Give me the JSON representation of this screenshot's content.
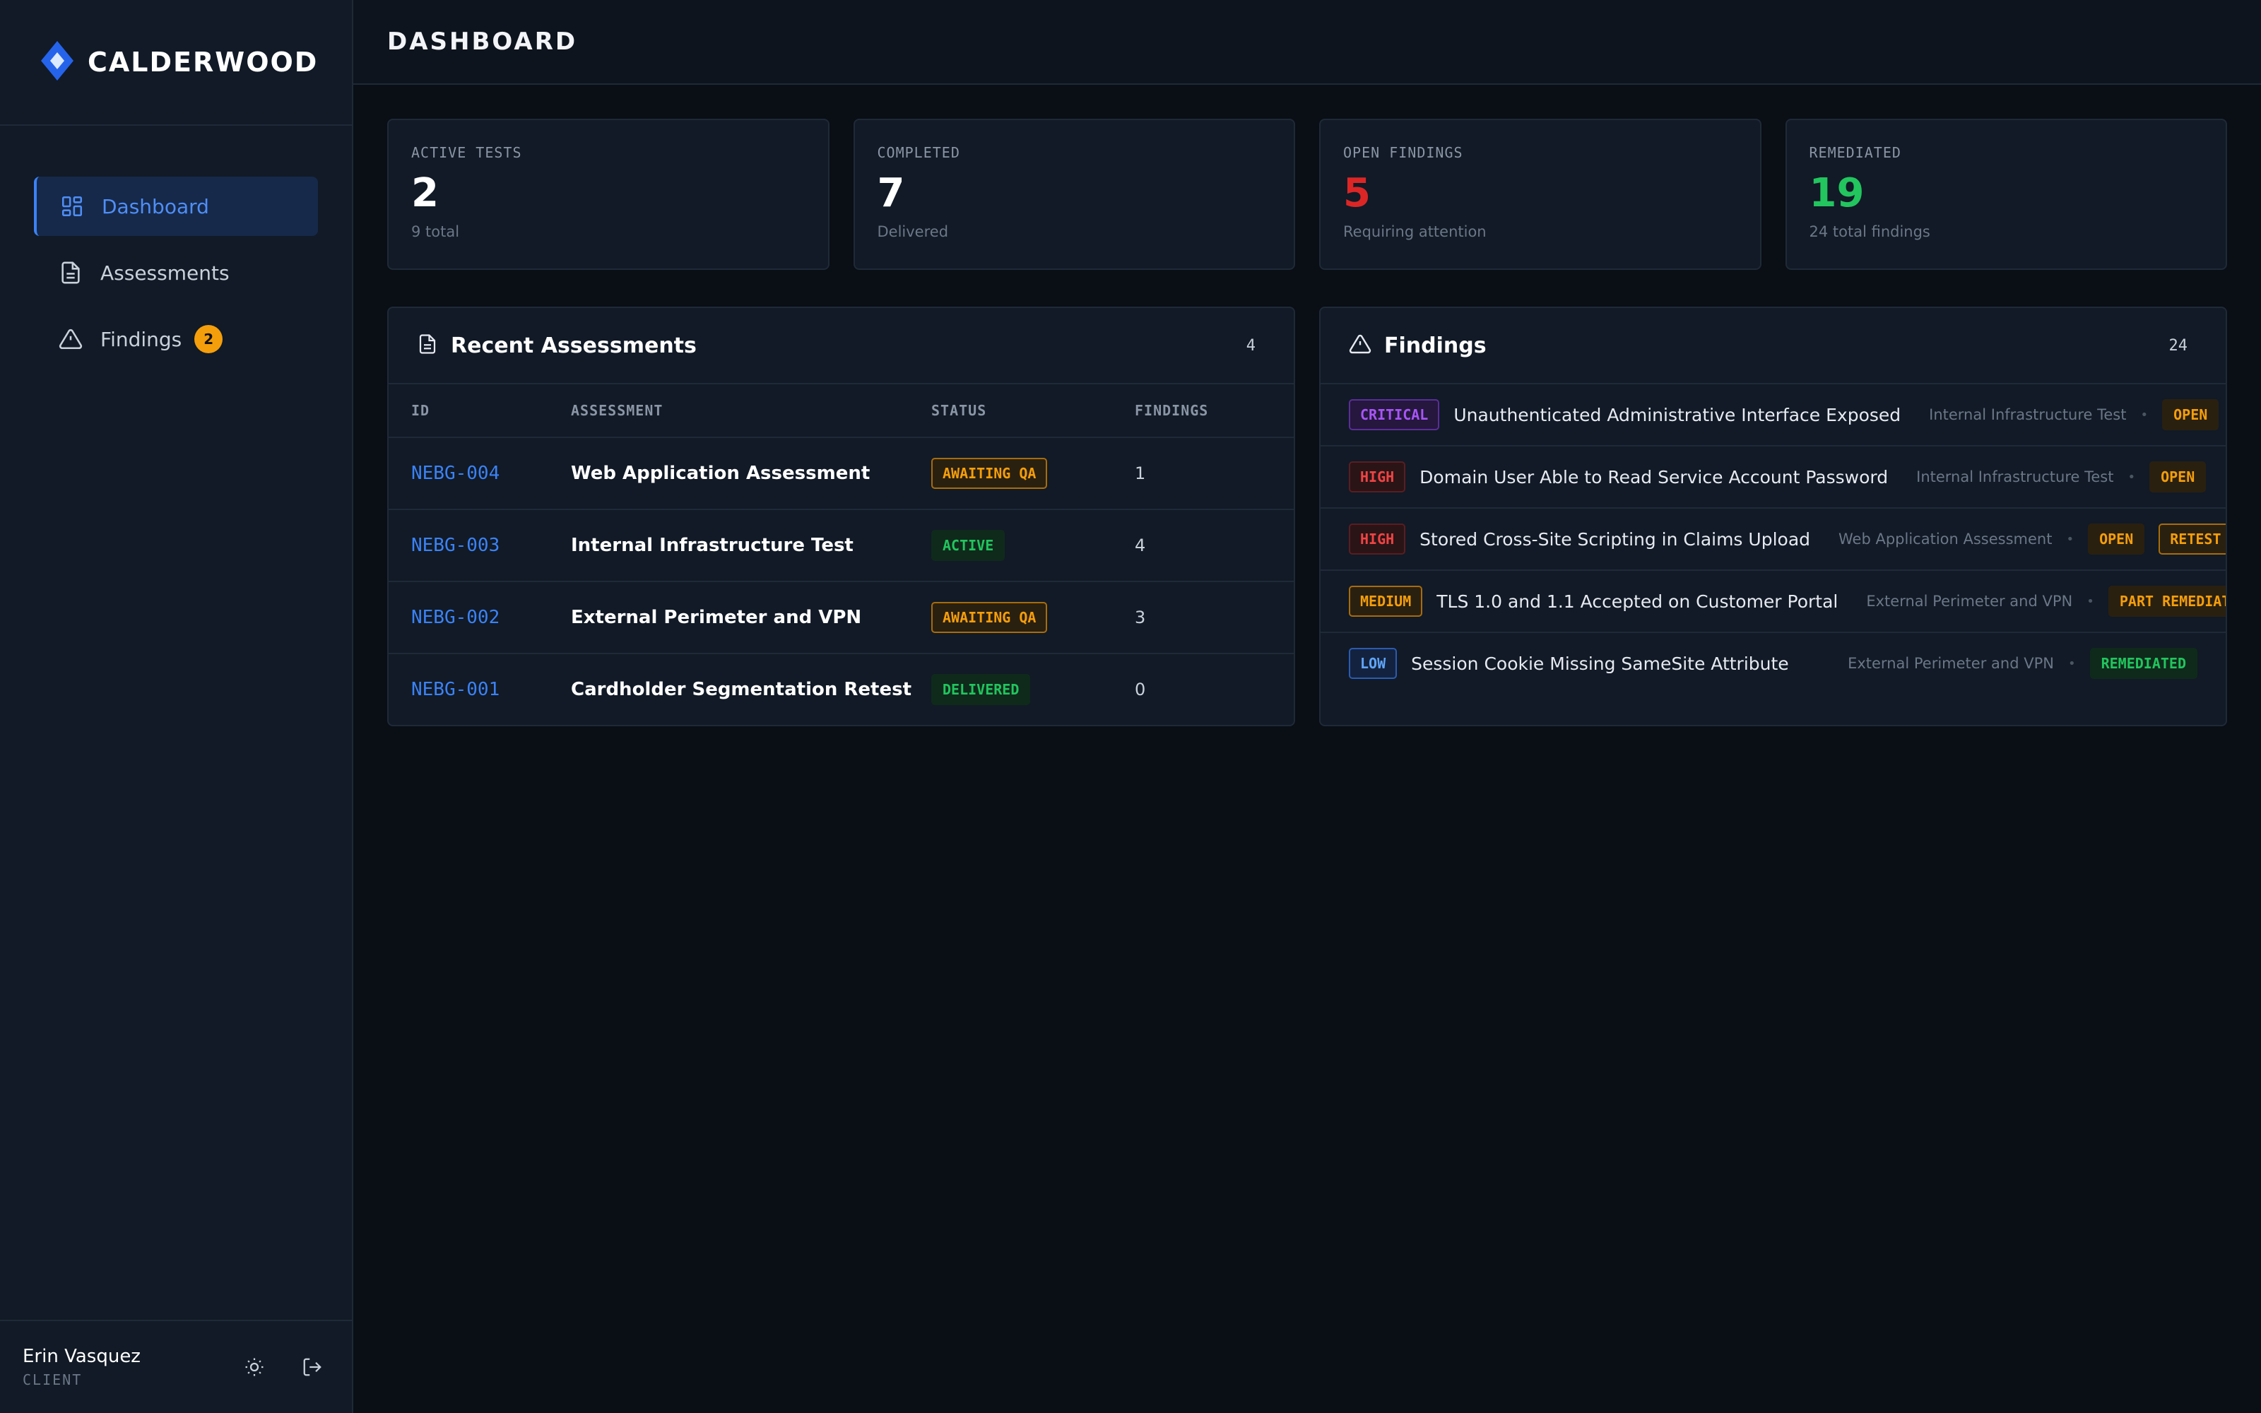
{
  "brand": {
    "name": "CALDERWOOD"
  },
  "sidebar": {
    "items": [
      {
        "label": "Dashboard",
        "icon": "dashboard-icon",
        "active": true
      },
      {
        "label": "Assessments",
        "icon": "document-icon"
      },
      {
        "label": "Findings",
        "icon": "warning-icon",
        "badge": "2"
      }
    ],
    "user": {
      "name": "Erin Vasquez",
      "role": "CLIENT"
    }
  },
  "header": {
    "title": "DASHBOARD"
  },
  "stats": [
    {
      "label": "ACTIVE TESTS",
      "value": "2",
      "sub": "9 total",
      "color": "#ffffff"
    },
    {
      "label": "COMPLETED",
      "value": "7",
      "sub": "Delivered",
      "color": "#ffffff"
    },
    {
      "label": "OPEN FINDINGS",
      "value": "5",
      "sub": "Requiring attention",
      "color": "#dc2626"
    },
    {
      "label": "REMEDIATED",
      "value": "19",
      "sub": "24 total findings",
      "color": "#22c55e"
    }
  ],
  "recent": {
    "title": "Recent Assessments",
    "count": "4",
    "columns": [
      "ID",
      "ASSESSMENT",
      "STATUS",
      "FINDINGS"
    ],
    "rows": [
      {
        "id": "NEBG-004",
        "name": "Web Application Assessment",
        "status": "AWAITING QA",
        "findings": "1"
      },
      {
        "id": "NEBG-003",
        "name": "Internal Infrastructure Test",
        "status": "ACTIVE",
        "findings": "4"
      },
      {
        "id": "NEBG-002",
        "name": "External Perimeter and VPN",
        "status": "AWAITING QA",
        "findings": "3"
      },
      {
        "id": "NEBG-001",
        "name": "Cardholder Segmentation Retest",
        "status": "DELIVERED",
        "findings": "0"
      }
    ]
  },
  "findings": {
    "title": "Findings",
    "count": "24",
    "items": [
      {
        "severity": "CRITICAL",
        "title": "Unauthenticated Administrative Interface Exposed",
        "source": "Internal Infrastructure Test",
        "statuses": [
          "OPEN"
        ]
      },
      {
        "severity": "HIGH",
        "title": "Domain User Able to Read Service Account Password",
        "source": "Internal Infrastructure Test",
        "statuses": [
          "OPEN"
        ]
      },
      {
        "severity": "HIGH",
        "title": "Stored Cross-Site Scripting in Claims Upload",
        "source": "Web Application Assessment",
        "statuses": [
          "OPEN",
          "RETEST"
        ]
      },
      {
        "severity": "MEDIUM",
        "title": "TLS 1.0 and 1.1 Accepted on Customer Portal",
        "source": "External Perimeter and VPN",
        "statuses": [
          "PART REMEDIATED"
        ]
      },
      {
        "severity": "LOW",
        "title": "Session Cookie Missing SameSite Attribute",
        "source": "External Perimeter and VPN",
        "statuses": [
          "REMEDIATED"
        ]
      }
    ]
  },
  "separator": "•"
}
